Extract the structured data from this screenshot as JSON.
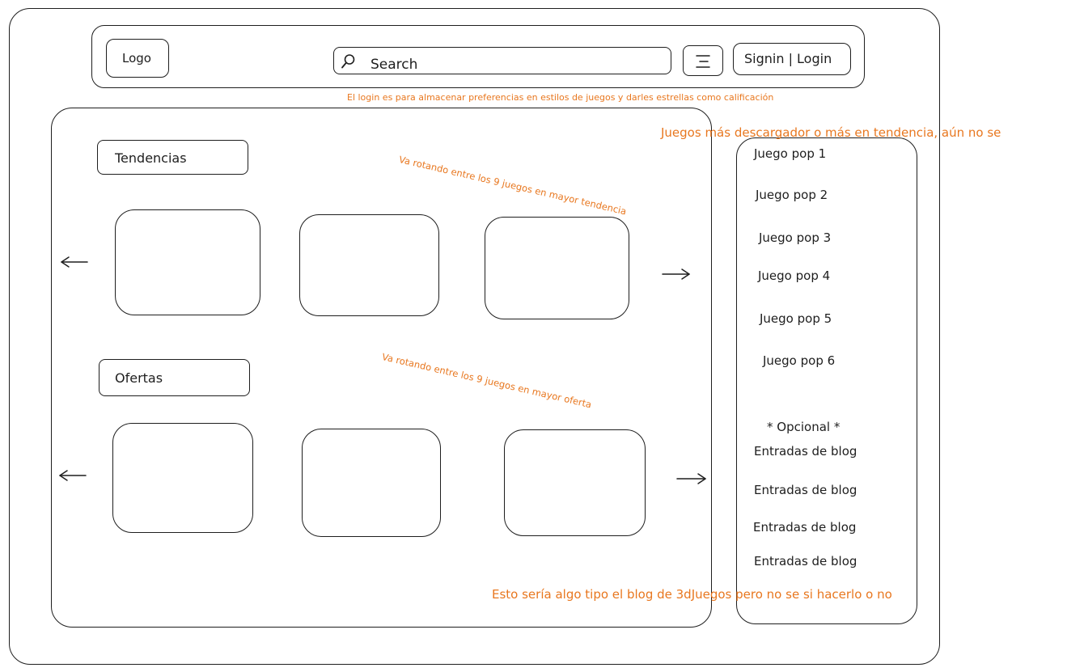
{
  "header": {
    "logo": "Logo",
    "search_placeholder": "Search",
    "signin": "Signin | Login"
  },
  "trending": {
    "title": "Tendencias",
    "note": "Va rotando entre los 9 juegos en mayor tendencia"
  },
  "offers": {
    "title": "Ofertas",
    "note": "Va rotando entre los 9 juegos en mayor oferta"
  },
  "sidebar": {
    "popular": [
      "Juego pop 1",
      "Juego pop 2",
      "Juego pop 3",
      "Juego pop 4",
      "Juego pop 5",
      "Juego pop 6"
    ],
    "optional": "* Opcional *",
    "blog": [
      "Entradas de blog",
      "Entradas de blog",
      "Entradas de blog",
      "Entradas de blog"
    ]
  },
  "annotations": {
    "login_note": "El login es para almacenar preferencias en estilos de juegos y darles estrellas como calificación",
    "popular_note": "Juegos más descargador o más en tendencia, aún no se",
    "blog_note": "Esto sería algo tipo el blog de 3dJuegos pero no se si hacerlo o no"
  },
  "colors": {
    "stroke": "#1e1e1e",
    "annotation": "#e8771f"
  }
}
